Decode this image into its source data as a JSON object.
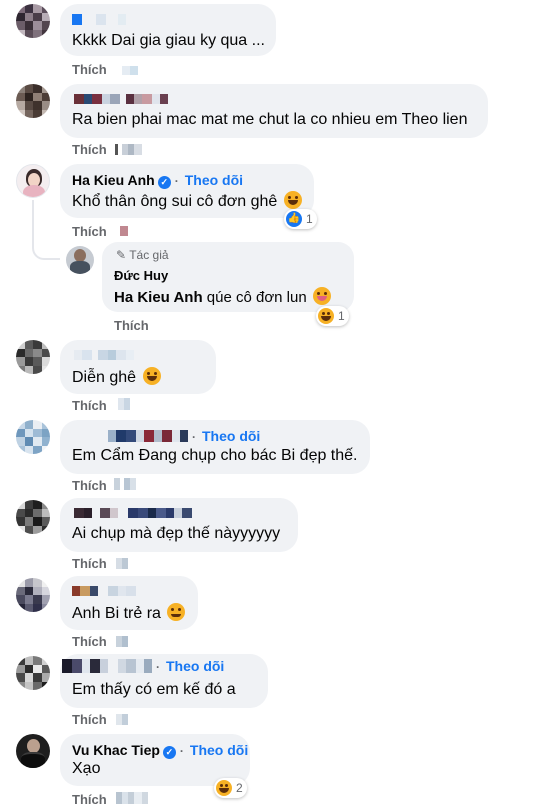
{
  "like_label": "Thích",
  "follow_label": "Theo dõi",
  "author_tag": "Tác giả",
  "comments": [
    {
      "name": "",
      "text": "Kkkk Dai gia giau ky qua ..."
    },
    {
      "name": "",
      "text": "Ra bien phai mac mat me chut la co nhieu em Theo lien"
    },
    {
      "name": "Ha Kieu Anh",
      "text": "Khổ thân ông sui cô đơn ghê",
      "reaction_count": "1"
    },
    {
      "name": "Đức Huy",
      "mention": "Ha Kieu Anh",
      "text": " qúe cô đơn lun",
      "reaction_count": "1"
    },
    {
      "name": "",
      "text": "Diễn ghê"
    },
    {
      "name": "",
      "text": "Em Cẩm Đang chụp cho bác Bi đẹp thế."
    },
    {
      "name": "",
      "text": "Ai chụp mà đẹp thế nàyyyyyy"
    },
    {
      "name": "",
      "text": "Anh Bi trẻ ra"
    },
    {
      "name": "",
      "text": "Em thấy có em kế đó a"
    },
    {
      "name": "Vu Khac Tiep",
      "text": "Xạo",
      "reaction_count": "2"
    }
  ],
  "colors": {
    "bubble": "#f0f2f5",
    "accent": "#1877f2",
    "muted": "#65676b"
  }
}
